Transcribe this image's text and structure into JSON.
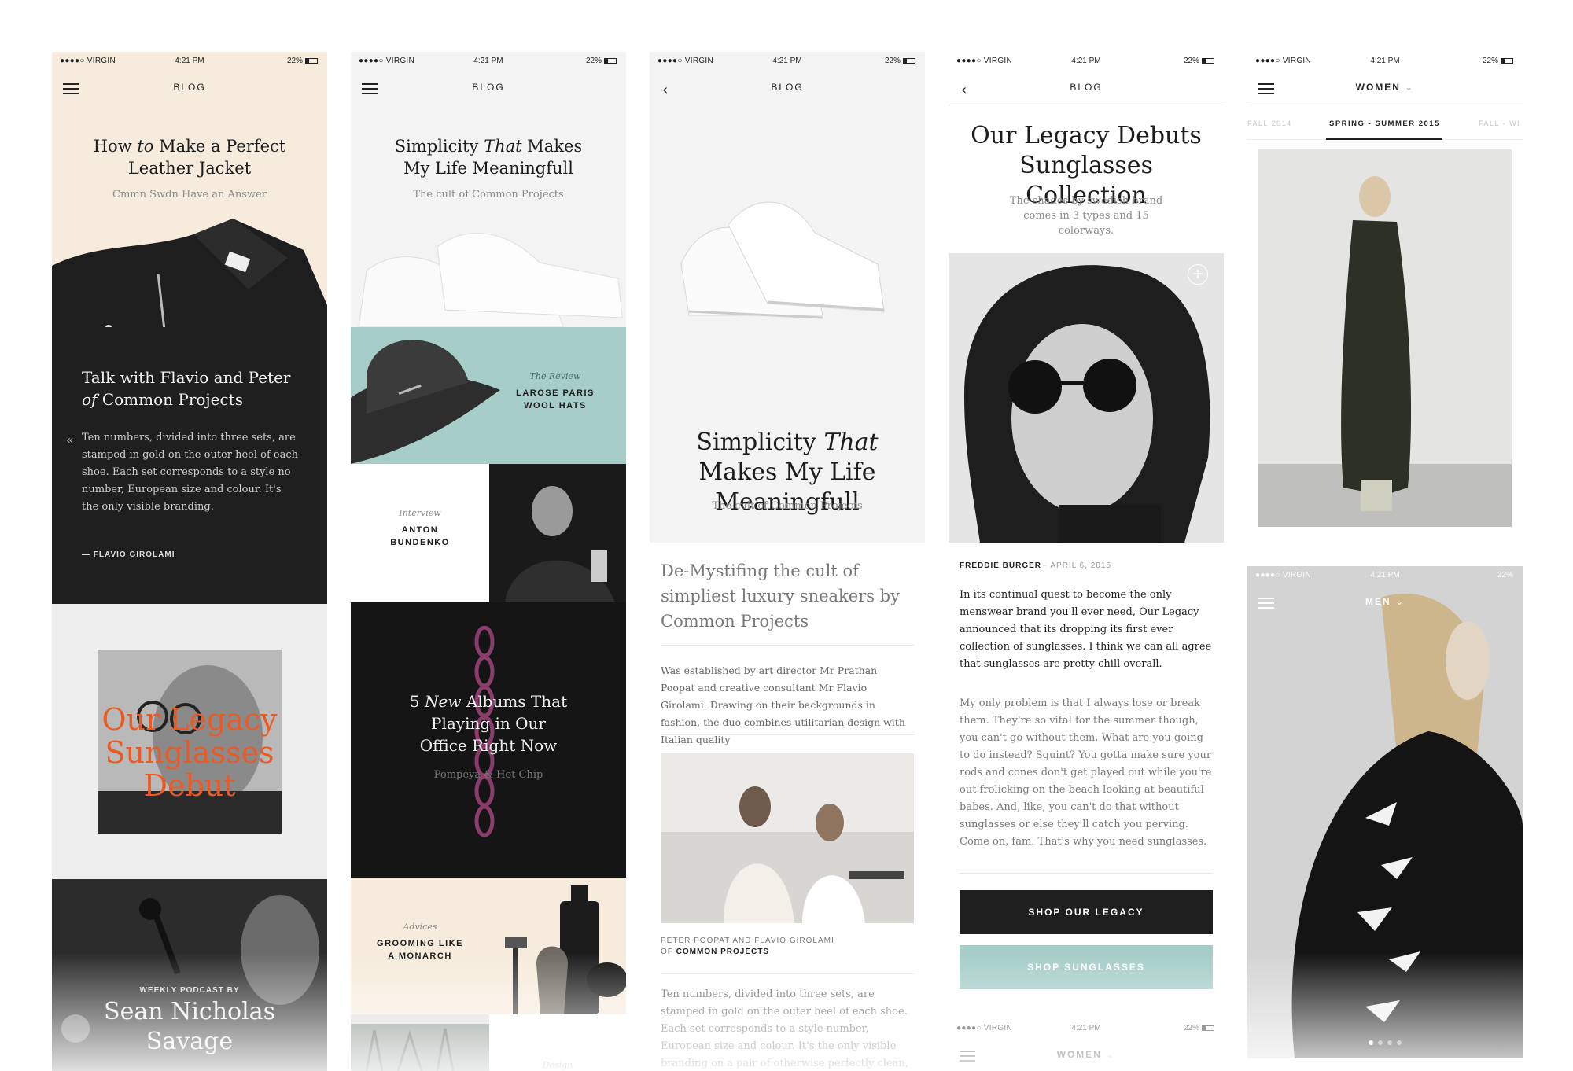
{
  "status": {
    "carrier": "●●●●○ VIRGIN",
    "time": "4:21 PM",
    "battery": "22%"
  },
  "colors": {
    "cream": "#f6ebdc",
    "dark": "#1f1f1f",
    "mint": "#a6cdc7",
    "accent": "#ec5a24",
    "light": "#eeeeee"
  },
  "phone1": {
    "nav_title": "BLOG",
    "hero": {
      "title1": "How",
      "title_em": "to",
      "title2": "Make a Perfect Leather Jacket",
      "subtitle": "Cmmn Swdn Have an Answer"
    },
    "talk": {
      "title1": "Talk with Flavio and Peter",
      "title_em": "of",
      "title2": "Common Projects",
      "quote": "Ten numbers, divided into three sets, are stamped in gold on the outer heel of each shoe.  Each set corresponds to a style no number, European size and colour. It's the only visible branding.",
      "author": "— FLAVIO GIROLAMI"
    },
    "promo": {
      "title": "Our Legacy Sunglasses Debut"
    },
    "podcast": {
      "kicker": "WEEKLY PODCAST BY",
      "name": "Sean Nicholas Savage"
    }
  },
  "phone2": {
    "nav_title": "BLOG",
    "hero": {
      "title1": "Simplicity",
      "title_em": "That",
      "title2": "Makes My Life Meaningfull",
      "subtitle": "The cult of Common Projects"
    },
    "review": {
      "kicker": "The Review",
      "title": "LAROSE PARIS WOOL HATS"
    },
    "interview": {
      "kicker": "Interview",
      "title": "ANTON BUNDENKO"
    },
    "albums": {
      "title_num": "5",
      "title_em": "New",
      "title2": "Albums That Playing in Our Office Right Now",
      "subtitle": "Pompeya & Hot Chip"
    },
    "advice": {
      "kicker": "Advices",
      "title": "GROOMING LIKE A MONARCH"
    },
    "design": {
      "kicker": "Design"
    }
  },
  "phone3": {
    "nav_title": "BLOG",
    "hero": {
      "title1": "Simplicity",
      "title_em": "That",
      "title2": "Makes My Life Meaningfull",
      "subtitle": "The cult of Common Projects"
    },
    "heading": "De-Mystifing the cult of simpliest luxury sneakers by Common Projects",
    "para1": "Was established by art director Mr Prathan Poopat and creative consultant Mr Flavio Girolami. Drawing on their backgrounds in fashion, the duo combines utilitarian design with Italian quality",
    "caption1": "PETER POOPAT AND FLAVIO GIROLAMI",
    "caption2_of": "OF",
    "caption2": "COMMON PROJECTS",
    "para2": "Ten numbers, divided into three sets, are stamped in gold on the outer heel of each shoe. Each set corresponds to a style number, European size and colour. It's the only visible branding on a pair of otherwise perfectly clean, pared-back Common"
  },
  "phone4": {
    "nav_title": "BLOG",
    "title": "Our Legacy Debuts Sunglasses Collection",
    "subtitle": "The shades by swedish brand comes in 3 types and 15 colorways.",
    "author": "FREDDIE BURGER",
    "date": "APRIL 6, 2015",
    "para1": "In its continual quest to become the only menswear brand you'll ever need, Our Legacy announced that its dropping its first ever collection of sunglasses. I think we can all agree that sunglasses are pretty chill overall.",
    "para2": "My only problem is that I always lose or break them. They're so vital for the summer though, you can't go without them. What are you going to do instead? Squint? You gotta make sure your rods and cones don't get played out while you're out frolicking on the beach looking at beautiful babes. And, like, you can't do that without sunglasses or else they'll catch you perving. Come on, fam. That's why you need sunglasses.",
    "btn_primary": "SHOP OUR LEGACY",
    "btn_secondary": "SHOP SUNGLASSES",
    "next_nav_title": "WOMEN"
  },
  "phone5": {
    "nav_title": "WOMEN",
    "tabs": [
      "FALL 2014",
      "SPRING - SUMMER 2015",
      "FALL - WI"
    ],
    "men_nav_title": "MEN"
  }
}
